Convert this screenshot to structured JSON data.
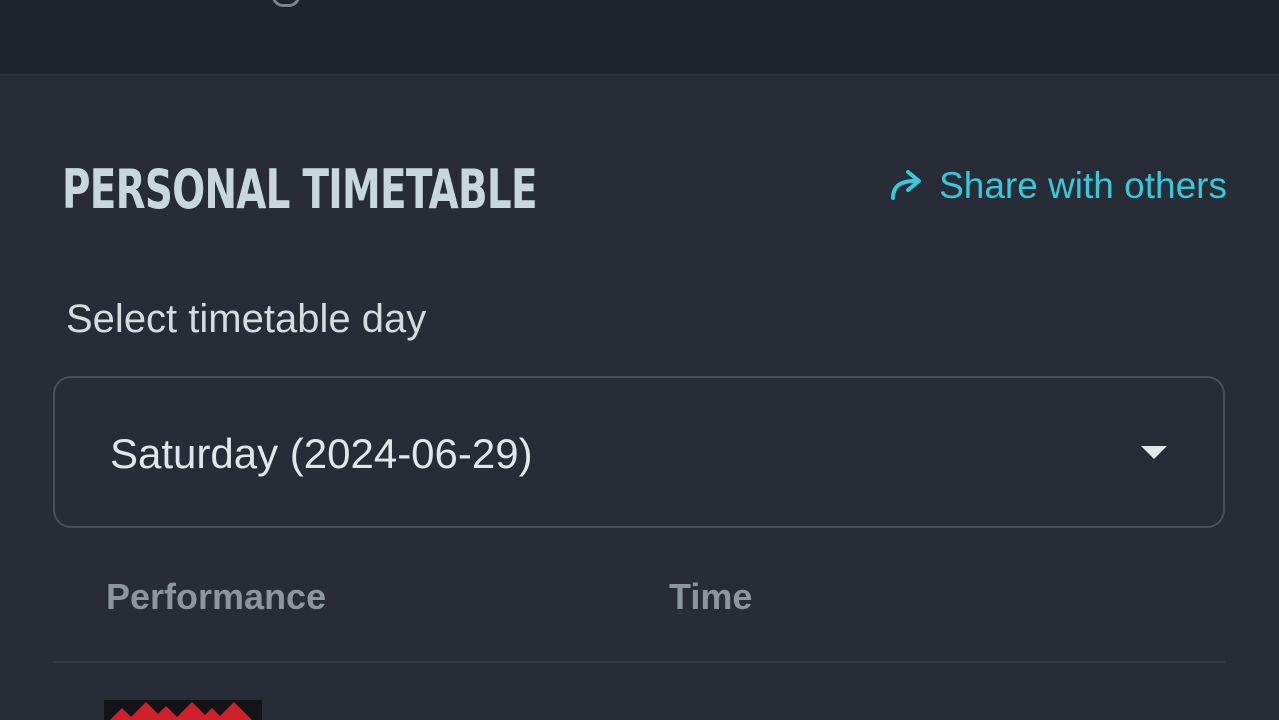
{
  "page": {
    "title": "PERSONAL TIMETABLE"
  },
  "share": {
    "label": "Share with others",
    "icon": "share-arrow-icon",
    "color": "#38c8d8"
  },
  "day_select": {
    "label": "Select timetable day",
    "selected": "Saturday (2024-06-29)",
    "icon": "chevron-down-icon"
  },
  "table": {
    "columns": [
      "Performance",
      "Time"
    ]
  },
  "colors": {
    "background": "#272c37",
    "header_bar": "#1f232b",
    "title": "#c8d7de",
    "logo_red": "#d0202a"
  }
}
